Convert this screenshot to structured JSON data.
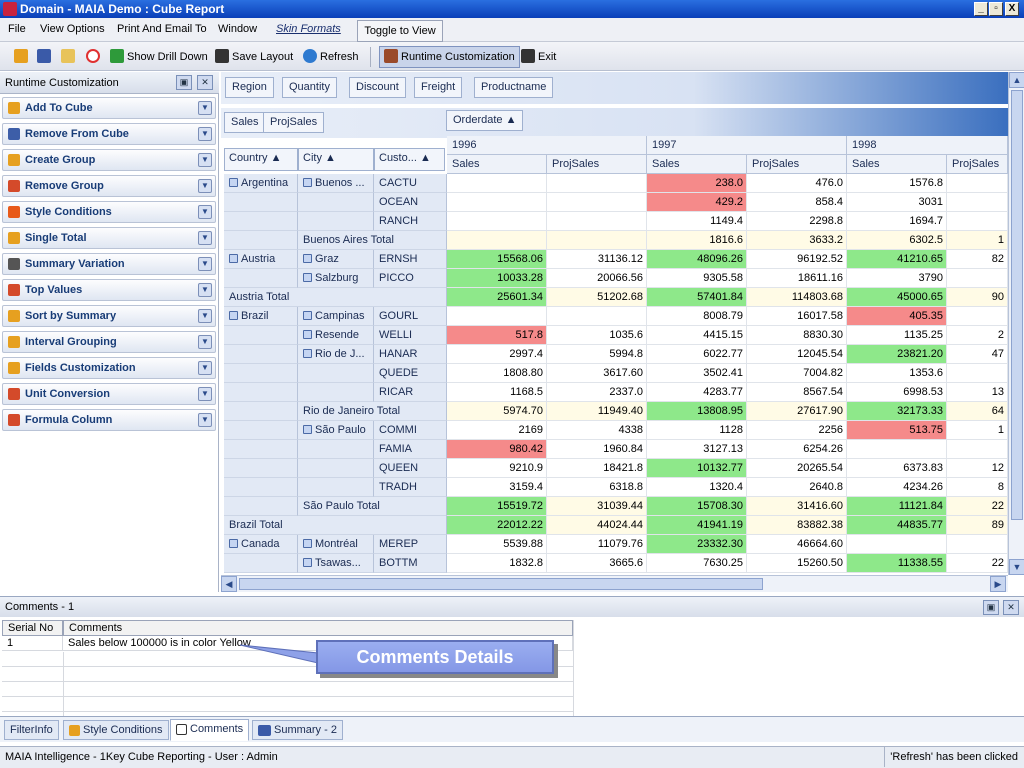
{
  "window": {
    "title": "Domain - MAIA Demo : Cube Report",
    "controls": [
      "_",
      "▫",
      "X"
    ]
  },
  "menu": {
    "items": [
      "File",
      "View Options",
      "Print And Email To",
      "Window"
    ],
    "skin_formats": "Skin Formats",
    "toggle": "Toggle to View"
  },
  "toolbar": {
    "show_drill_down": "Show Drill Down",
    "save_layout": "Save Layout",
    "refresh": "Refresh",
    "runtime_customization": "Runtime Customization",
    "exit": "Exit"
  },
  "left_panel": {
    "title": "Runtime Customization",
    "items": [
      {
        "label": "Add To Cube",
        "color": "#e6a020"
      },
      {
        "label": "Remove From Cube",
        "color": "#3d5ea8"
      },
      {
        "label": "Create Group",
        "color": "#e6a020"
      },
      {
        "label": "Remove Group",
        "color": "#d44a2a"
      },
      {
        "label": "Style Conditions",
        "color": "#e85a1a"
      },
      {
        "label": "Single Total",
        "color": "#e6a020"
      },
      {
        "label": "Summary Variation",
        "color": "#555555"
      },
      {
        "label": "Top Values",
        "color": "#d44a2a"
      },
      {
        "label": "Sort by Summary",
        "color": "#e6a020"
      },
      {
        "label": "Interval Grouping",
        "color": "#e6a020"
      },
      {
        "label": "Fields Customization",
        "color": "#e6a020"
      },
      {
        "label": "Unit Conversion",
        "color": "#d44a2a"
      },
      {
        "label": "Formula Column",
        "color": "#d44a2a"
      }
    ]
  },
  "pivot": {
    "filter_fields": [
      "Region",
      "Quantity",
      "Discount",
      "Freight",
      "Productname"
    ],
    "data_fields": [
      "Sales",
      "ProjSales"
    ],
    "column_field": "Orderdate",
    "row_fields": [
      "Country",
      "City",
      "Custo..."
    ],
    "years": [
      "1996",
      "1997",
      "1998"
    ],
    "measures": [
      "Sales",
      "ProjSales",
      "Sales",
      "ProjSales",
      "Sales",
      "ProjSales"
    ],
    "colors": {
      "green": "#8ee88a",
      "red": "#f58a8a",
      "yellow": "#fffbe6",
      "none": "#ffffff"
    },
    "rows": [
      {
        "country": "Argentina",
        "city": "Buenos ...",
        "cust": "CACTU",
        "v": [
          "",
          "",
          "238.0",
          "476.0",
          "1576.8",
          ""
        ],
        "c": [
          "",
          "",
          "red",
          "",
          "",
          ""
        ]
      },
      {
        "country": "",
        "city": "",
        "cust": "OCEAN",
        "v": [
          "",
          "",
          "429.2",
          "858.4",
          "3031",
          ""
        ],
        "c": [
          "",
          "",
          "red",
          "",
          "",
          ""
        ]
      },
      {
        "country": "",
        "city": "",
        "cust": "RANCH",
        "v": [
          "",
          "",
          "1149.4",
          "2298.8",
          "1694.7",
          ""
        ],
        "c": [
          "",
          "",
          "",
          "",
          "",
          ""
        ]
      },
      {
        "country": "",
        "city": "Buenos Aires Total",
        "cust": "",
        "v": [
          "",
          "",
          "1816.6",
          "3633.2",
          "6302.5",
          "1"
        ],
        "c": [
          "yellow",
          "yellow",
          "yellow",
          "yellow",
          "yellow",
          "yellow"
        ]
      },
      {
        "country": "Austria",
        "city": "Graz",
        "cust": "ERNSH",
        "v": [
          "15568.06",
          "31136.12",
          "48096.26",
          "96192.52",
          "41210.65",
          "82"
        ],
        "c": [
          "green",
          "",
          "green",
          "",
          "green",
          ""
        ]
      },
      {
        "country": "",
        "city": "Salzburg",
        "cust": "PICCO",
        "v": [
          "10033.28",
          "20066.56",
          "9305.58",
          "18611.16",
          "3790",
          ""
        ],
        "c": [
          "green",
          "",
          "",
          "",
          "",
          ""
        ]
      },
      {
        "country": "Austria Total",
        "city": "",
        "cust": "",
        "v": [
          "25601.34",
          "51202.68",
          "57401.84",
          "114803.68",
          "45000.65",
          "90"
        ],
        "c": [
          "green",
          "yellow",
          "green",
          "yellow",
          "green",
          "yellow"
        ]
      },
      {
        "country": "Brazil",
        "city": "Campinas",
        "cust": "GOURL",
        "v": [
          "",
          "",
          "8008.79",
          "16017.58",
          "405.35",
          ""
        ],
        "c": [
          "",
          "",
          "",
          "",
          "red",
          ""
        ]
      },
      {
        "country": "",
        "city": "Resende",
        "cust": "WELLI",
        "v": [
          "517.8",
          "1035.6",
          "4415.15",
          "8830.30",
          "1135.25",
          "2"
        ],
        "c": [
          "red",
          "",
          "",
          "",
          "",
          ""
        ]
      },
      {
        "country": "",
        "city": "Rio de J...",
        "cust": "HANAR",
        "v": [
          "2997.4",
          "5994.8",
          "6022.77",
          "12045.54",
          "23821.20",
          "47"
        ],
        "c": [
          "",
          "",
          "",
          "",
          "green",
          ""
        ]
      },
      {
        "country": "",
        "city": "",
        "cust": "QUEDE",
        "v": [
          "1808.80",
          "3617.60",
          "3502.41",
          "7004.82",
          "1353.6",
          ""
        ],
        "c": [
          "",
          "",
          "",
          "",
          "",
          ""
        ]
      },
      {
        "country": "",
        "city": "",
        "cust": "RICAR",
        "v": [
          "1168.5",
          "2337.0",
          "4283.77",
          "8567.54",
          "6998.53",
          "13"
        ],
        "c": [
          "",
          "",
          "",
          "",
          "",
          ""
        ]
      },
      {
        "country": "",
        "city": "Rio de Janeiro Total",
        "cust": "",
        "v": [
          "5974.70",
          "11949.40",
          "13808.95",
          "27617.90",
          "32173.33",
          "64"
        ],
        "c": [
          "yellow",
          "yellow",
          "green",
          "yellow",
          "green",
          "yellow"
        ]
      },
      {
        "country": "",
        "city": "São Paulo",
        "cust": "COMMI",
        "v": [
          "2169",
          "4338",
          "1128",
          "2256",
          "513.75",
          "1"
        ],
        "c": [
          "",
          "",
          "",
          "",
          "red",
          ""
        ]
      },
      {
        "country": "",
        "city": "",
        "cust": "FAMIA",
        "v": [
          "980.42",
          "1960.84",
          "3127.13",
          "6254.26",
          "",
          ""
        ],
        "c": [
          "red",
          "",
          "",
          "",
          "",
          ""
        ]
      },
      {
        "country": "",
        "city": "",
        "cust": "QUEEN",
        "v": [
          "9210.9",
          "18421.8",
          "10132.77",
          "20265.54",
          "6373.83",
          "12"
        ],
        "c": [
          "",
          "",
          "green",
          "",
          "",
          ""
        ]
      },
      {
        "country": "",
        "city": "",
        "cust": "TRADH",
        "v": [
          "3159.4",
          "6318.8",
          "1320.4",
          "2640.8",
          "4234.26",
          "8"
        ],
        "c": [
          "",
          "",
          "",
          "",
          "",
          ""
        ]
      },
      {
        "country": "",
        "city": "São Paulo Total",
        "cust": "",
        "v": [
          "15519.72",
          "31039.44",
          "15708.30",
          "31416.60",
          "11121.84",
          "22"
        ],
        "c": [
          "green",
          "yellow",
          "green",
          "yellow",
          "green",
          "yellow"
        ]
      },
      {
        "country": "Brazil Total",
        "city": "",
        "cust": "",
        "v": [
          "22012.22",
          "44024.44",
          "41941.19",
          "83882.38",
          "44835.77",
          "89"
        ],
        "c": [
          "green",
          "yellow",
          "green",
          "yellow",
          "green",
          "yellow"
        ]
      },
      {
        "country": "Canada",
        "city": "Montréal",
        "cust": "MEREP",
        "v": [
          "5539.88",
          "11079.76",
          "23332.30",
          "46664.60",
          "",
          ""
        ],
        "c": [
          "",
          "",
          "green",
          "",
          "",
          ""
        ]
      },
      {
        "country": "",
        "city": "Tsawas...",
        "cust": "BOTTM",
        "v": [
          "1832.8",
          "3665.6",
          "7630.25",
          "15260.50",
          "11338.55",
          "22"
        ],
        "c": [
          "",
          "",
          "",
          "",
          "green",
          ""
        ]
      }
    ]
  },
  "comments": {
    "title": "Comments - 1",
    "headers": [
      "Serial No",
      "Comments"
    ],
    "rows": [
      {
        "serial": "1",
        "text": "Sales below 100000 is in color Yellow"
      }
    ],
    "callout": "Comments Details"
  },
  "tabs": [
    "FilterInfo",
    "Style Conditions",
    "Comments",
    "Summary - 2"
  ],
  "status": {
    "left": "MAIA Intelligence - 1Key Cube Reporting - User : Admin",
    "right": "'Refresh' has been clicked"
  }
}
